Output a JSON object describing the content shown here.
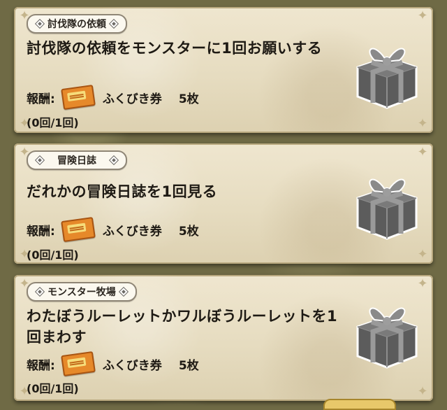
{
  "quests": [
    {
      "category": "討伐隊の依頼",
      "title": "討伐隊の依頼をモンスターに1回お願いする",
      "reward_label": "報酬:",
      "reward_name": "ふくびき券",
      "reward_count": "5枚",
      "progress": "(0回/1回)"
    },
    {
      "category": "冒険日誌",
      "title": "だれかの冒険日誌を1回見る",
      "reward_label": "報酬:",
      "reward_name": "ふくびき券",
      "reward_count": "5枚",
      "progress": "(0回/1回)"
    },
    {
      "category": "モンスター牧場",
      "title": "わたぼうルーレットかワルぼうルーレットを1回まわす",
      "reward_label": "報酬:",
      "reward_name": "ふくびき券",
      "reward_count": "5枚",
      "progress": "(0回/1回)"
    }
  ],
  "icons": {
    "reward_icon": "ticket-icon",
    "prize_icon": "gift-box-icon"
  },
  "colors": {
    "card_bg": "#efe6cf",
    "ticket": "#e6892a",
    "gift": "#6a6a6a"
  }
}
